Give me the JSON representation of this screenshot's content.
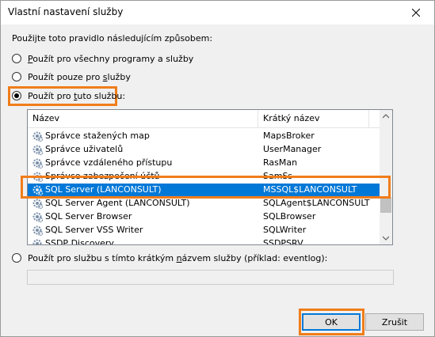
{
  "window": {
    "title": "Vlastní nastavení služby"
  },
  "intro": "Použijte toto pravidlo následujícím způsobem:",
  "options": [
    {
      "pre": "",
      "key": "P",
      "post": "oužít pro všechny programy a služby",
      "checked": false
    },
    {
      "pre": "Použít pouze pro ",
      "key": "s",
      "post": "lužby",
      "checked": false
    },
    {
      "pre": "Použít pro ",
      "key": "t",
      "post": "uto službu:",
      "checked": true
    },
    {
      "pre": "Použít pro službu s tímto krátkým ",
      "key": "n",
      "post": "ázvem služby (příklad: eventlog):",
      "checked": false
    }
  ],
  "list": {
    "columns": [
      "Název",
      "Krátký název"
    ],
    "rows": [
      {
        "name": "Správce stažených map",
        "short": "MapsBroker"
      },
      {
        "name": "Správce uživatelů",
        "short": "UserManager"
      },
      {
        "name": "Správce vzdáleného přístupu",
        "short": "RasMan"
      },
      {
        "name": "Správce zabezpečení účtů",
        "short": "SamSs"
      },
      {
        "name": "SQL Server (LANCONSULT)",
        "short": "MSSQL$LANCONSULT",
        "selected": true
      },
      {
        "name": "SQL Server Agent (LANCONSULT)",
        "short": "SQLAgent$LANCONSULT"
      },
      {
        "name": "SQL Server Browser",
        "short": "SQLBrowser"
      },
      {
        "name": "SQL Server VSS Writer",
        "short": "SQLWriter"
      },
      {
        "name": "SSDP Discovery",
        "short": "SSDPSRV"
      }
    ]
  },
  "service_name_input": {
    "value": ""
  },
  "buttons": {
    "ok": "OK",
    "cancel": "Zrušit"
  },
  "colors": {
    "selection": "#0078d7",
    "highlight": "#f07d1a"
  }
}
